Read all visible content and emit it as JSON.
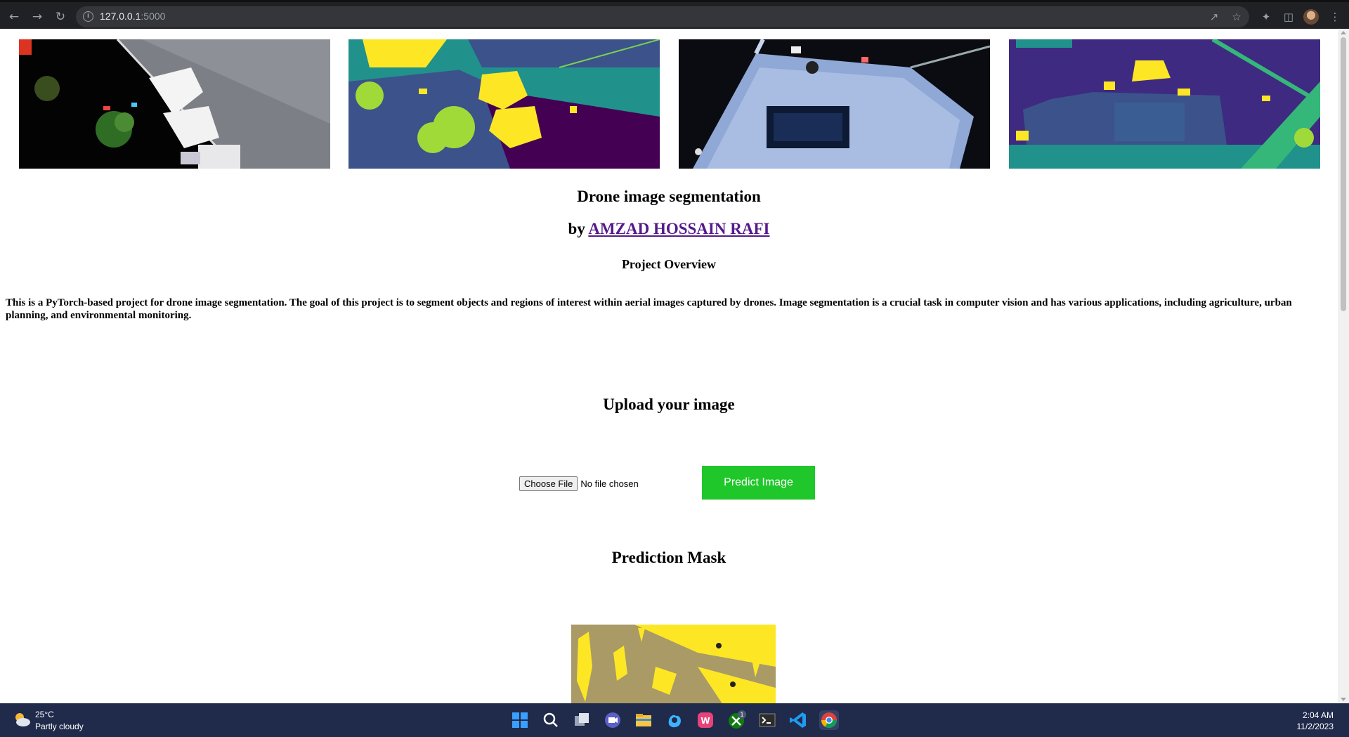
{
  "browser": {
    "url_host": "127.0.0.1",
    "url_port": ":5000",
    "icons": [
      "back-icon",
      "forward-icon",
      "reload-icon",
      "site-info-icon",
      "share-icon",
      "bookmark-star-icon",
      "extensions-icon",
      "side-panel-icon",
      "profile-avatar",
      "menu-icon"
    ]
  },
  "page": {
    "title": "Drone image segmentation",
    "byline_prefix": "by ",
    "author": "AMZAD HOSSAIN RAFI",
    "overview_heading": "Project Overview",
    "description": "This is a PyTorch-based project for drone image segmentation. The goal of this project is to segment objects and regions of interest within aerial images captured by drones. Image segmentation is a crucial task in computer vision and has various applications, including agriculture, urban planning, and environmental monitoring.",
    "upload_heading": "Upload your image",
    "file_button": "Choose File",
    "file_status": "No file chosen",
    "predict_button": "Predict Image",
    "prediction_heading": "Prediction Mask",
    "colors": {
      "predict_button": "#1fc72a",
      "link": "#551a8b"
    }
  },
  "taskbar": {
    "temperature": "25°C",
    "condition": "Partly cloudy",
    "time": "2:04 AM",
    "date": "11/2/2023",
    "apps": [
      "start-icon",
      "search-icon",
      "task-view-icon",
      "meet-icon",
      "file-explorer-icon",
      "copilot-icon",
      "wps-icon",
      "xbox-icon",
      "terminal-icon",
      "vscode-icon",
      "chrome-icon"
    ],
    "xbox_badge": "1"
  }
}
